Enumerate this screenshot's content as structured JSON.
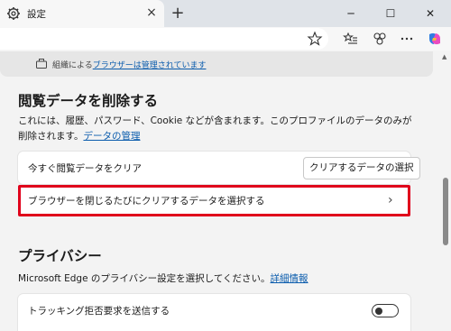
{
  "window": {
    "tab_title": "設定",
    "tab_icon": "gear-icon",
    "close_tab_glyph": "×",
    "new_tab_glyph": "+",
    "minimize_glyph": "─",
    "maximize_glyph": "☐",
    "close_window_glyph": "✕"
  },
  "banner": {
    "prefix": "組織による",
    "link": "ブラウザーは管理されています"
  },
  "clear_data": {
    "heading": "閲覧データを削除する",
    "description": "これには、履歴、パスワード、Cookie などが含まれます。このプロファイルのデータのみが削除されます。",
    "manage_link": "データの管理",
    "clear_now_label": "今すぐ閲覧データをクリア",
    "choose_button": "クリアするデータの選択",
    "on_close_label": "ブラウザーを閉じるたびにクリアするデータを選択する",
    "chevron": "›"
  },
  "privacy": {
    "heading": "プライバシー",
    "description": "Microsoft Edge のプライバシー設定を選択してください。",
    "more_link": "詳細情報",
    "dnt_label": "トラッキング拒否要求を送信する",
    "dnt_enabled": false
  },
  "colors": {
    "highlight": "#e0001b",
    "link": "#0b5cad"
  }
}
